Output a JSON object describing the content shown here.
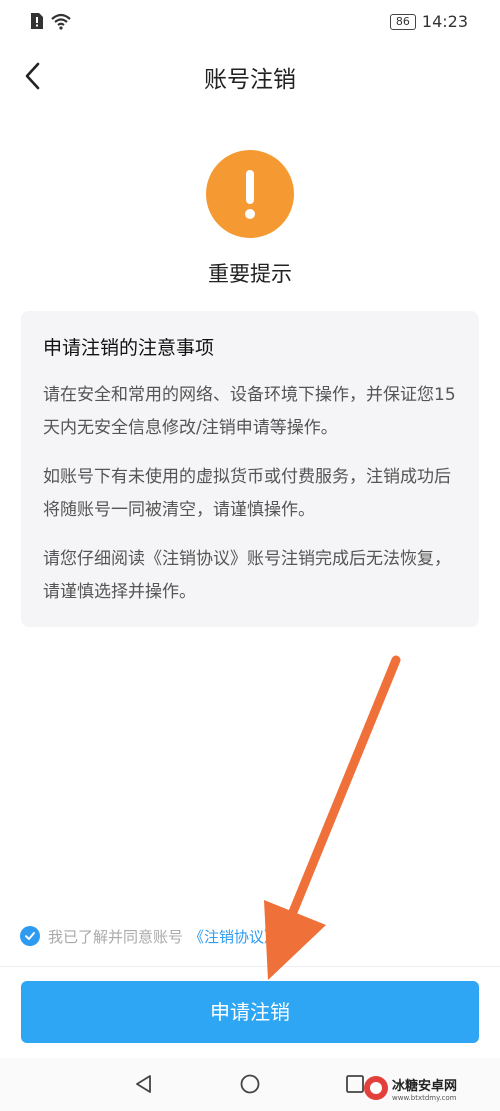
{
  "status_bar": {
    "time": "14:23",
    "battery": "86"
  },
  "header": {
    "title": "账号注销"
  },
  "warning": {
    "title": "重要提示"
  },
  "notice": {
    "heading": "申请注销的注意事项",
    "paragraphs": [
      "请在安全和常用的网络、设备环境下操作，并保证您15天内无安全信息修改/注销申请等操作。",
      "如账号下有未使用的虚拟货币或付费服务，注销成功后将随账号一同被清空，请谨慎操作。",
      "请您仔细阅读《注销协议》账号注销完成后无法恢复，请谨慎选择并操作。"
    ]
  },
  "agreement": {
    "text": "我已了解并同意账号",
    "link": "《注销协议》",
    "checked": true
  },
  "submit": {
    "label": "申请注销"
  },
  "colors": {
    "accent": "#2fa6f3",
    "warning": "#f59a32",
    "annotation_arrow": "#f0703a"
  },
  "watermark": {
    "text": "冰糖安卓网",
    "url": "www.btxtdmy.com"
  }
}
